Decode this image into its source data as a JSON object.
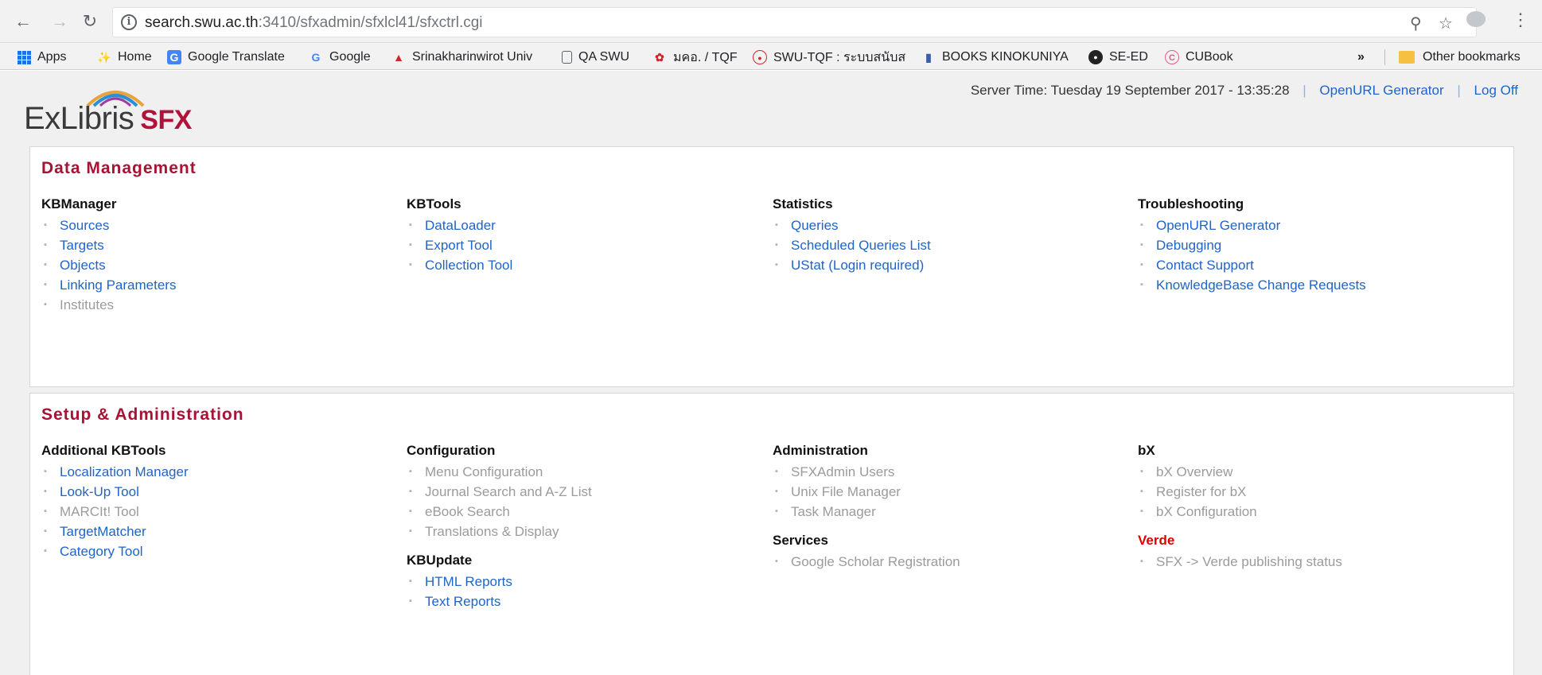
{
  "browser": {
    "url_host": "search.swu.ac.th",
    "url_rest": ":3410/sfxadmin/sfxlcl41/sfxctrl.cgi",
    "bookmarks": [
      {
        "label": "Apps",
        "icon": "apps-icon"
      },
      {
        "label": "Home",
        "icon": "home-icon"
      },
      {
        "label": "Google Translate",
        "icon": "translate-icon"
      },
      {
        "label": "Google",
        "icon": "google-icon"
      },
      {
        "label": "Srinakharinwirot Univ",
        "icon": "university-icon"
      },
      {
        "label": "QA SWU",
        "icon": "page-icon"
      },
      {
        "label": "มคอ. / TQF",
        "icon": "tqf-icon"
      },
      {
        "label": "SWU-TQF : ระบบสนับส",
        "icon": "swu-tqf-icon"
      },
      {
        "label": "BOOKS KINOKUNIYA",
        "icon": "kinokuniya-icon"
      },
      {
        "label": "SE-ED",
        "icon": "seed-icon"
      },
      {
        "label": "CUBook",
        "icon": "cubook-icon"
      }
    ],
    "more": "»",
    "other_bookmarks": "Other bookmarks"
  },
  "header": {
    "logo_main": "ExLibris",
    "logo_product": "SFX",
    "server_time": "Server Time: Tuesday 19 September 2017 - 13:35:28",
    "openurl_generator": "OpenURL Generator",
    "log_off": "Log Off",
    "sep": "|"
  },
  "data_management": {
    "title": "Data Management",
    "kbmanager": {
      "title": "KBManager",
      "items": [
        "Sources",
        "Targets",
        "Objects",
        "Linking Parameters",
        "Institutes"
      ]
    },
    "kbtools": {
      "title": "KBTools",
      "items": [
        "DataLoader",
        "Export Tool",
        "Collection Tool"
      ]
    },
    "statistics": {
      "title": "Statistics",
      "items": [
        "Queries",
        "Scheduled Queries List",
        "UStat (Login required)"
      ]
    },
    "troubleshooting": {
      "title": "Troubleshooting",
      "items": [
        "OpenURL Generator",
        "Debugging",
        "Contact Support",
        "KnowledgeBase Change Requests"
      ]
    }
  },
  "setup_admin": {
    "title": "Setup & Administration",
    "additional_kbtools": {
      "title": "Additional KBTools",
      "items": [
        "Localization Manager",
        "Look-Up Tool",
        "MARCIt! Tool",
        "TargetMatcher",
        "Category Tool"
      ]
    },
    "configuration": {
      "title": "Configuration",
      "items": [
        "Menu Configuration",
        "Journal Search and A-Z List",
        "eBook Search",
        "Translations & Display"
      ]
    },
    "kbupdate": {
      "title": "KBUpdate",
      "items": [
        "HTML Reports",
        "Text Reports"
      ]
    },
    "administration": {
      "title": "Administration",
      "items": [
        "SFXAdmin Users",
        "Unix File Manager",
        "Task Manager"
      ]
    },
    "services": {
      "title": "Services",
      "items": [
        "Google Scholar Registration"
      ]
    },
    "bx": {
      "title": "bX",
      "items": [
        "bX Overview",
        "Register for bX",
        "bX Configuration"
      ]
    },
    "verde": {
      "title": "Verde",
      "items": [
        "SFX -> Verde publishing status"
      ]
    }
  },
  "colors": {
    "link": "#1f64c8",
    "disabled": "#9b9b9b",
    "section_title": "#a81235",
    "verde": "#e00000"
  }
}
